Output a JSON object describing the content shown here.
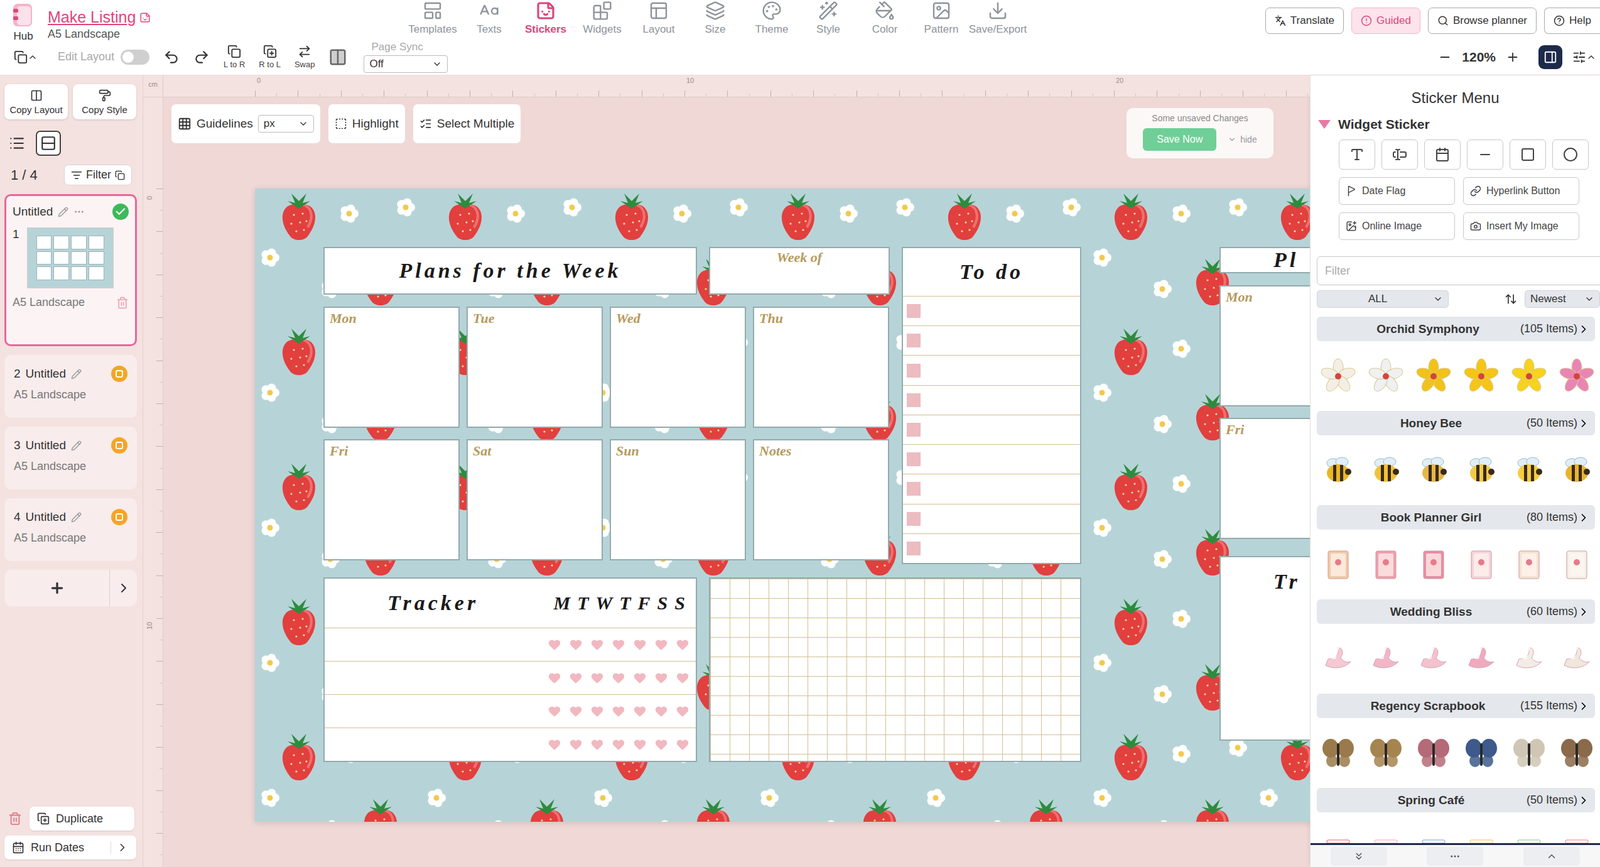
{
  "app": {
    "logo_label": "Hub",
    "title": "Make Listing",
    "subtitle": "A5 Landscape"
  },
  "nav_tabs": [
    {
      "label": "Templates",
      "selected": false
    },
    {
      "label": "Texts",
      "selected": false
    },
    {
      "label": "Stickers",
      "selected": true
    },
    {
      "label": "Widgets",
      "selected": false
    },
    {
      "label": "Layout",
      "selected": false
    },
    {
      "label": "Size",
      "selected": false
    },
    {
      "label": "Theme",
      "selected": false
    },
    {
      "label": "Style",
      "selected": false
    },
    {
      "label": "Color",
      "selected": false
    },
    {
      "label": "Pattern",
      "selected": false
    },
    {
      "label": "Save/Export",
      "selected": false
    }
  ],
  "top_actions": [
    {
      "label": "Translate",
      "highlighted": false
    },
    {
      "label": "Guided",
      "highlighted": true
    },
    {
      "label": "Browse planner",
      "highlighted": false
    },
    {
      "label": "Help",
      "highlighted": false
    }
  ],
  "toolbar": {
    "edit_layout": {
      "label": "Edit Layout",
      "on": false
    },
    "page_tools": [
      "L to R",
      "R to L",
      "Swap"
    ],
    "page_sync": {
      "label": "Page Sync",
      "value": "Off"
    }
  },
  "zoom": {
    "value": "120%"
  },
  "sidebar": {
    "copy_buttons": [
      "Copy Layout",
      "Copy Style"
    ],
    "view_modes": [
      {
        "mode": "list",
        "selected": false
      },
      {
        "mode": "grid",
        "selected": true
      }
    ],
    "page_counter": "1 / 4",
    "filter": "Filter",
    "pages": [
      {
        "number": "1",
        "name": "Untitled",
        "size": "A5 Landscape",
        "selected": true,
        "saved": true
      },
      {
        "number": "2",
        "name": "Untitled",
        "size": "A5 Landscape",
        "selected": false,
        "saved": false
      },
      {
        "number": "3",
        "name": "Untitled",
        "size": "A5 Landscape",
        "selected": false,
        "saved": false
      },
      {
        "number": "4",
        "name": "Untitled",
        "size": "A5 Landscape",
        "selected": false,
        "saved": false
      }
    ],
    "duplicate": "Duplicate",
    "run_dates": "Run Dates"
  },
  "canvas": {
    "ruler_unit": "cm",
    "top_ruler": [
      "0",
      "10",
      "20"
    ],
    "left_ruler": [
      "0",
      "10"
    ],
    "guidelines": {
      "label": "Guidelines",
      "unit": "px"
    },
    "highlight": "Highlight",
    "select_multiple": "Select Multiple",
    "save_notice": {
      "message": "Some unsaved Changes",
      "save": "Save Now",
      "hide": "hide"
    }
  },
  "planner": {
    "title": "Plans for the Week",
    "week_of": "Week of",
    "todo_title": "To do",
    "todo": [
      {
        "checked": false
      },
      {
        "checked": false
      },
      {
        "checked": false
      },
      {
        "checked": false
      },
      {
        "checked": false
      },
      {
        "checked": false
      },
      {
        "checked": false
      },
      {
        "checked": false
      },
      {
        "checked": false
      }
    ],
    "days": [
      "Mon",
      "Tue",
      "Wed",
      "Thu",
      "Fri",
      "Sat",
      "Sun",
      "Notes"
    ],
    "tracker_title": "Tracker",
    "tracker_days": "MTWTFSS",
    "tracker_rows": [
      {
        "marks": [
          false,
          false,
          false,
          false,
          false,
          false,
          false
        ]
      },
      {
        "marks": [
          false,
          false,
          false,
          false,
          false,
          false,
          false
        ]
      },
      {
        "marks": [
          false,
          false,
          false,
          false,
          false,
          false,
          false
        ]
      },
      {
        "marks": [
          false,
          false,
          false,
          false,
          false,
          false,
          false
        ]
      }
    ]
  },
  "right_page": {
    "title": "Pl",
    "days": [
      "Mon",
      "Fri"
    ],
    "tracker_title": "Tr"
  },
  "sticker_panel": {
    "title": "Sticker Menu",
    "section": "Widget Sticker",
    "widget_buttons": [
      "Date Flag",
      "Hyperlink Button",
      "Online Image",
      "Insert My Image"
    ],
    "filter_placeholder": "Filter",
    "category_filter": "ALL",
    "sort": "Newest",
    "categories": [
      {
        "name": "Orchid Symphony",
        "count": "(105 Items)",
        "kind": "orchid",
        "stickers": [
          "#f4efe6",
          "#eef0f2",
          "#f1c21b",
          "#f5c518",
          "#f7d21e",
          "#e985b5"
        ]
      },
      {
        "name": "Honey Bee",
        "count": "(50 Items)",
        "kind": "bee",
        "stickers": [
          "#e9b824",
          "#f0c23a",
          "#e5b64a",
          "#f2c94c",
          "#f5cd3d",
          "#e8b530"
        ]
      },
      {
        "name": "Book Planner Girl",
        "count": "(80 Items)",
        "kind": "book",
        "stickers": [
          "#f2c9a8",
          "#ef9fb0",
          "#e98ca6",
          "#f6d3da",
          "#f3e2d3",
          "#f5f0ea"
        ]
      },
      {
        "name": "Wedding Bliss",
        "count": "(60 Items)",
        "kind": "bird",
        "stickers": [
          "#f4c9d4",
          "#f1b7c9",
          "#f3c2cf",
          "#f0aabd",
          "#f3ece6",
          "#f1e6dc"
        ]
      },
      {
        "name": "Regency Scrapbook",
        "count": "(155 Items)",
        "kind": "butterfly",
        "stickers": [
          "#9a7a4a",
          "#a6844f",
          "#b56a78",
          "#3d5a8a",
          "#cfc6b4",
          "#8a6a4a"
        ]
      },
      {
        "name": "Spring Café",
        "count": "(50 Items)",
        "kind": "cafe",
        "stickers": [
          "#e45a6a",
          "#f0a8b8",
          "#7a9ad8",
          "#f3c14b",
          "#8cc08a",
          "#e87a8a"
        ]
      }
    ]
  }
}
